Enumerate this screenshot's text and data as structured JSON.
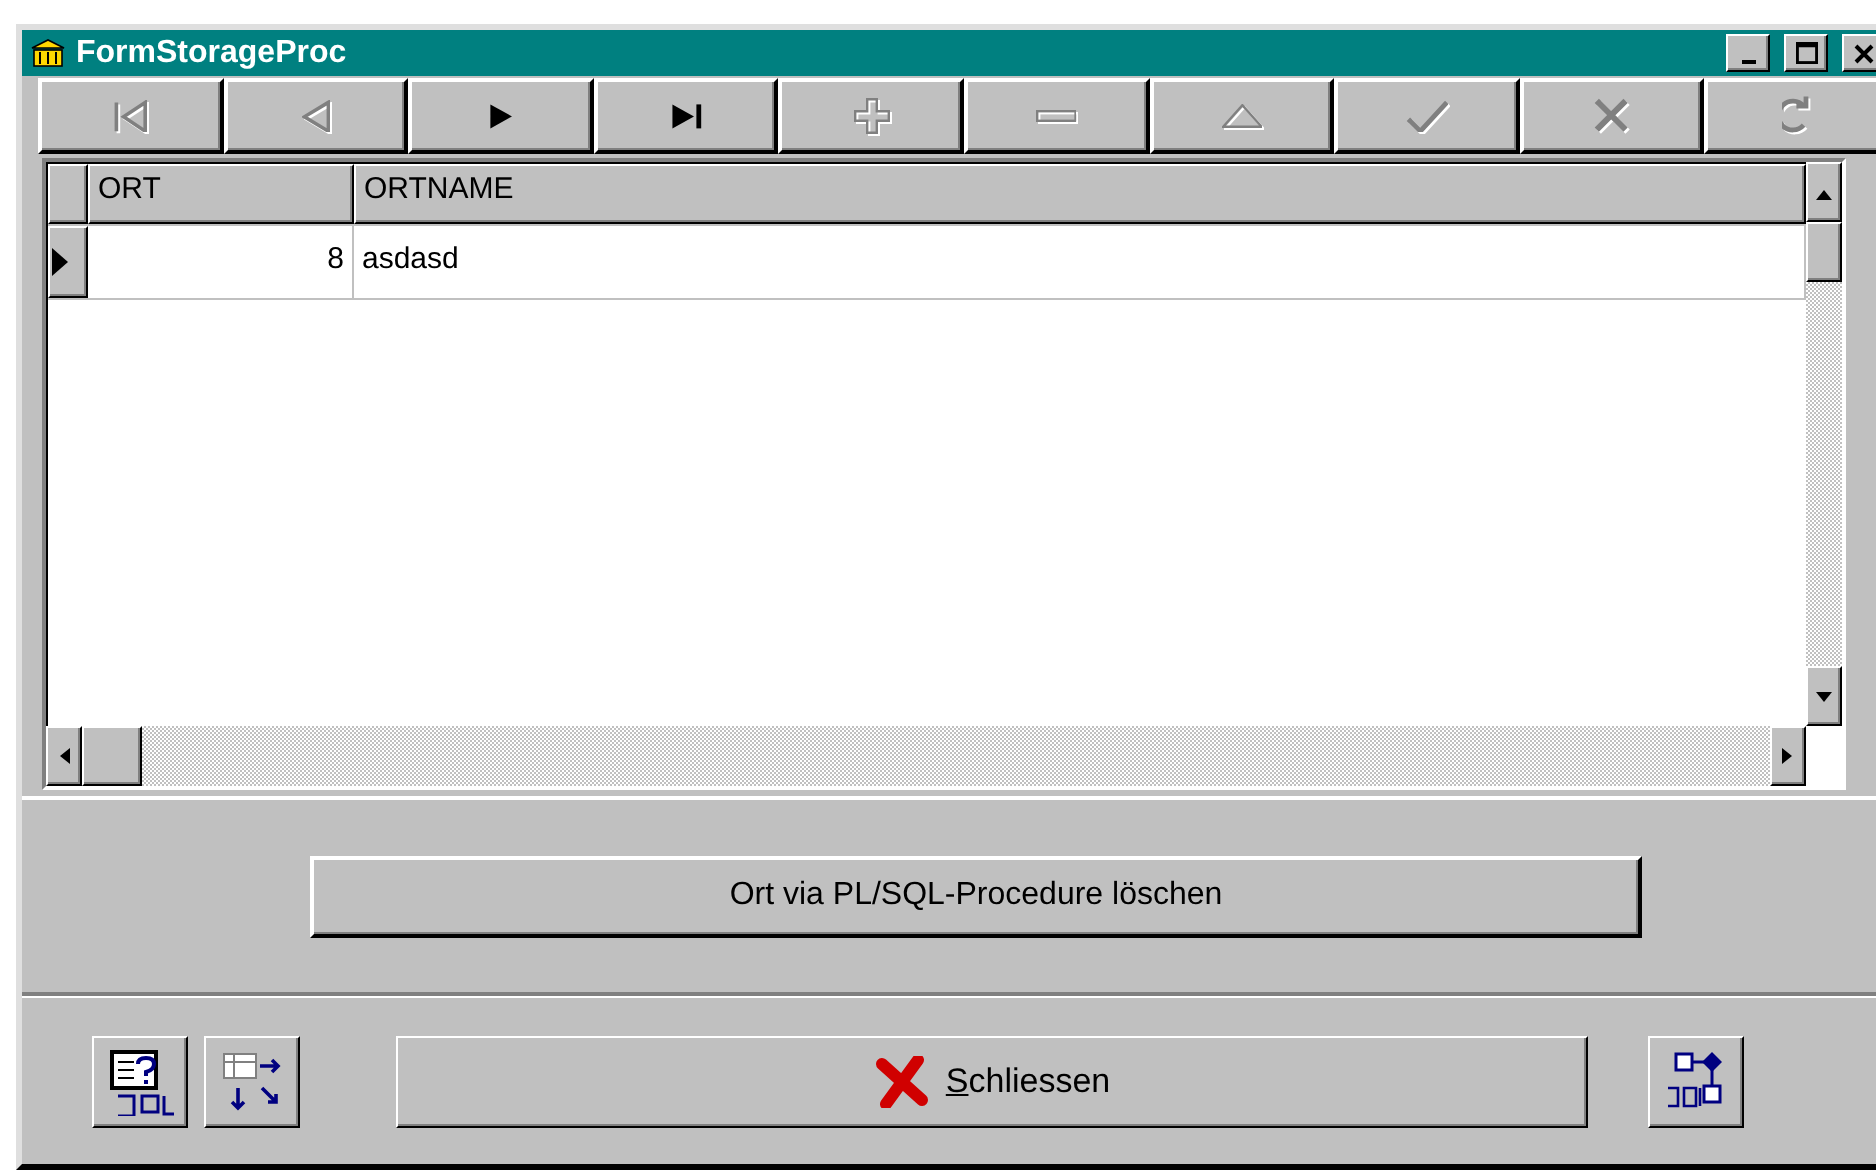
{
  "window": {
    "title": "FormStorageProc"
  },
  "navigator": [
    {
      "kind": "first",
      "disabled": true
    },
    {
      "kind": "prior",
      "disabled": true
    },
    {
      "kind": "next",
      "disabled": false
    },
    {
      "kind": "last",
      "disabled": false
    },
    {
      "kind": "insert",
      "disabled": true
    },
    {
      "kind": "delete",
      "disabled": true
    },
    {
      "kind": "edit",
      "disabled": true
    },
    {
      "kind": "post",
      "disabled": true
    },
    {
      "kind": "cancel",
      "disabled": true
    },
    {
      "kind": "refresh",
      "disabled": true
    }
  ],
  "grid": {
    "columns": [
      "ORT",
      "ORTNAME"
    ],
    "rows": [
      {
        "cells": [
          "8",
          "asdasd"
        ],
        "selected": true
      }
    ]
  },
  "delete_button": {
    "label": "Ort via PL/SQL-Procedure löschen"
  },
  "close_button": {
    "label": "Schliessen",
    "underline_first": true
  }
}
